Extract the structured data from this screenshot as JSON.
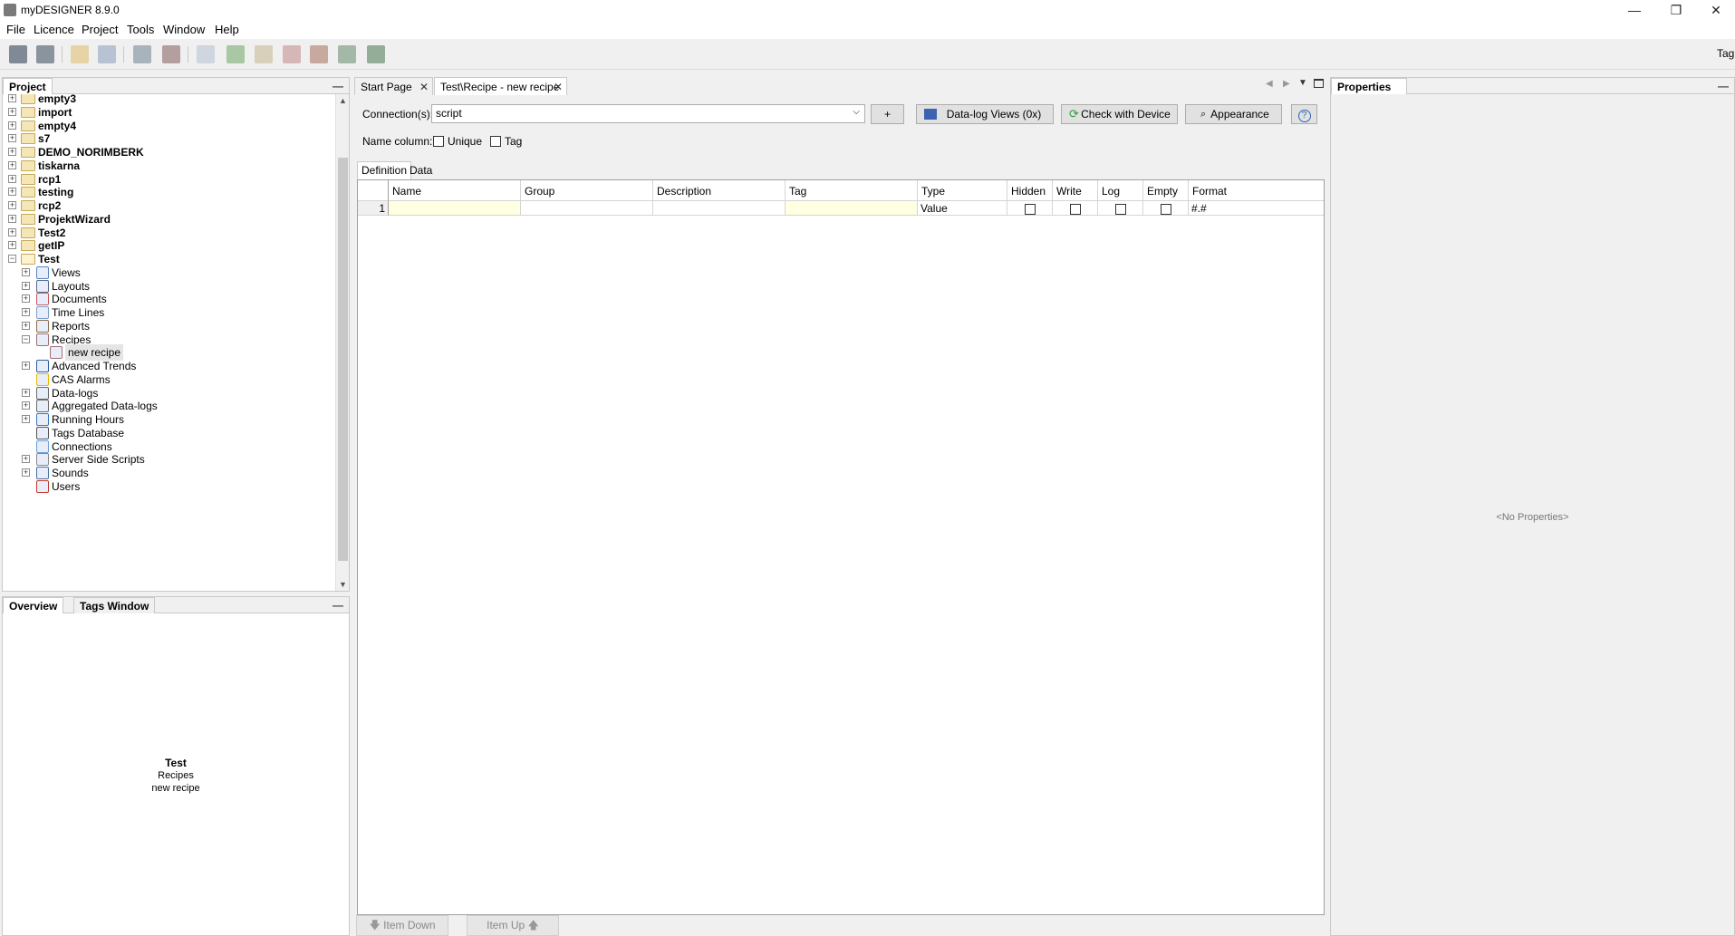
{
  "window": {
    "title": "myDESIGNER 8.9.0",
    "minimize": "—",
    "restore": "❐",
    "close": "✕"
  },
  "menu": [
    "File",
    "Licence",
    "Project",
    "Tools",
    "Window",
    "Help"
  ],
  "toolbar": {
    "right_label": "Tag"
  },
  "project_panel": {
    "title": "Project",
    "tree": [
      {
        "label": "empty3",
        "bold": true,
        "level": 0,
        "expander": "+",
        "icon": "folder-icon"
      },
      {
        "label": "import",
        "bold": true,
        "level": 0,
        "expander": "+",
        "icon": "folder-icon"
      },
      {
        "label": "empty4",
        "bold": true,
        "level": 0,
        "expander": "+",
        "icon": "folder-icon"
      },
      {
        "label": "s7",
        "bold": true,
        "level": 0,
        "expander": "+",
        "icon": "folder-icon"
      },
      {
        "label": "DEMO_NORIMBERK",
        "bold": true,
        "level": 0,
        "expander": "+",
        "icon": "folder-icon"
      },
      {
        "label": "tiskarna",
        "bold": true,
        "level": 0,
        "expander": "+",
        "icon": "folder-icon"
      },
      {
        "label": "rcp1",
        "bold": true,
        "level": 0,
        "expander": "+",
        "icon": "folder-icon"
      },
      {
        "label": "testing",
        "bold": true,
        "level": 0,
        "expander": "+",
        "icon": "folder-icon"
      },
      {
        "label": "rcp2",
        "bold": true,
        "level": 0,
        "expander": "+",
        "icon": "folder-icon"
      },
      {
        "label": "ProjektWizard",
        "bold": true,
        "level": 0,
        "expander": "+",
        "icon": "folder-icon"
      },
      {
        "label": "Test2",
        "bold": true,
        "level": 0,
        "expander": "+",
        "icon": "folder-icon"
      },
      {
        "label": "getIP",
        "bold": true,
        "level": 0,
        "expander": "+",
        "icon": "folder-icon"
      },
      {
        "label": "Test",
        "bold": true,
        "level": 0,
        "expander": "−",
        "icon": "folder-open-icon"
      },
      {
        "label": "Views",
        "bold": false,
        "level": 1,
        "expander": "+",
        "icon": "views-icon"
      },
      {
        "label": "Layouts",
        "bold": false,
        "level": 1,
        "expander": "+",
        "icon": "layouts-icon"
      },
      {
        "label": "Documents",
        "bold": false,
        "level": 1,
        "expander": "+",
        "icon": "documents-icon"
      },
      {
        "label": "Time Lines",
        "bold": false,
        "level": 1,
        "expander": "+",
        "icon": "timelines-icon"
      },
      {
        "label": "Reports",
        "bold": false,
        "level": 1,
        "expander": "+",
        "icon": "reports-icon"
      },
      {
        "label": "Recipes",
        "bold": false,
        "level": 1,
        "expander": "−",
        "icon": "recipes-icon"
      },
      {
        "label": "new recipe",
        "bold": false,
        "level": 2,
        "expander": "",
        "icon": "recipe-icon",
        "selected": true
      },
      {
        "label": "Advanced Trends",
        "bold": false,
        "level": 1,
        "expander": "+",
        "icon": "trends-icon"
      },
      {
        "label": "CAS Alarms",
        "bold": false,
        "level": 1,
        "expander": "",
        "icon": "alarm-icon"
      },
      {
        "label": "Data-logs",
        "bold": false,
        "level": 1,
        "expander": "+",
        "icon": "datalogs-icon"
      },
      {
        "label": "Aggregated Data-logs",
        "bold": false,
        "level": 1,
        "expander": "+",
        "icon": "aggregated-datalogs-icon"
      },
      {
        "label": "Running Hours",
        "bold": false,
        "level": 1,
        "expander": "+",
        "icon": "clock-icon"
      },
      {
        "label": "Tags Database",
        "bold": false,
        "level": 1,
        "expander": "",
        "icon": "database-icon"
      },
      {
        "label": "Connections",
        "bold": false,
        "level": 1,
        "expander": "",
        "icon": "connections-icon"
      },
      {
        "label": "Server Side Scripts",
        "bold": false,
        "level": 1,
        "expander": "+",
        "icon": "scripts-icon"
      },
      {
        "label": "Sounds",
        "bold": false,
        "level": 1,
        "expander": "+",
        "icon": "sounds-icon"
      },
      {
        "label": "Users",
        "bold": false,
        "level": 1,
        "expander": "",
        "icon": "users-icon"
      }
    ]
  },
  "overview_panel": {
    "tabs": [
      "Overview",
      "Tags Window"
    ],
    "line1": "Test",
    "line2": "Recipes",
    "line3": "new recipe"
  },
  "editor": {
    "tabs": [
      {
        "label": "Start Page",
        "active": false
      },
      {
        "label": "Test\\Recipe - new recipe",
        "active": true
      }
    ],
    "connections_label": "Connection(s):",
    "connections_value": "script",
    "add_label": "+",
    "datalog_views_label": "Data-log Views (0x)",
    "check_device_label": "Check with Device",
    "appearance_label": "Appearance",
    "help_label": "?",
    "name_column_label": "Name column:",
    "unique_label": "Unique",
    "tag_label": "Tag",
    "subtabs": [
      "Definition",
      "Data"
    ],
    "columns": [
      "Name",
      "Group",
      "Description",
      "Tag",
      "Type",
      "Hidden",
      "Write",
      "Log",
      "Empty",
      "Format"
    ],
    "rows": [
      {
        "num": "1",
        "name": "",
        "group": "",
        "description": "",
        "tag": "",
        "type": "Value",
        "hidden": false,
        "write": false,
        "log": false,
        "empty": false,
        "format": "#.#"
      }
    ],
    "item_down_label": "Item Down",
    "item_up_label": "Item Up"
  },
  "properties_panel": {
    "title": "Properties",
    "empty_text": "<No Properties>"
  }
}
